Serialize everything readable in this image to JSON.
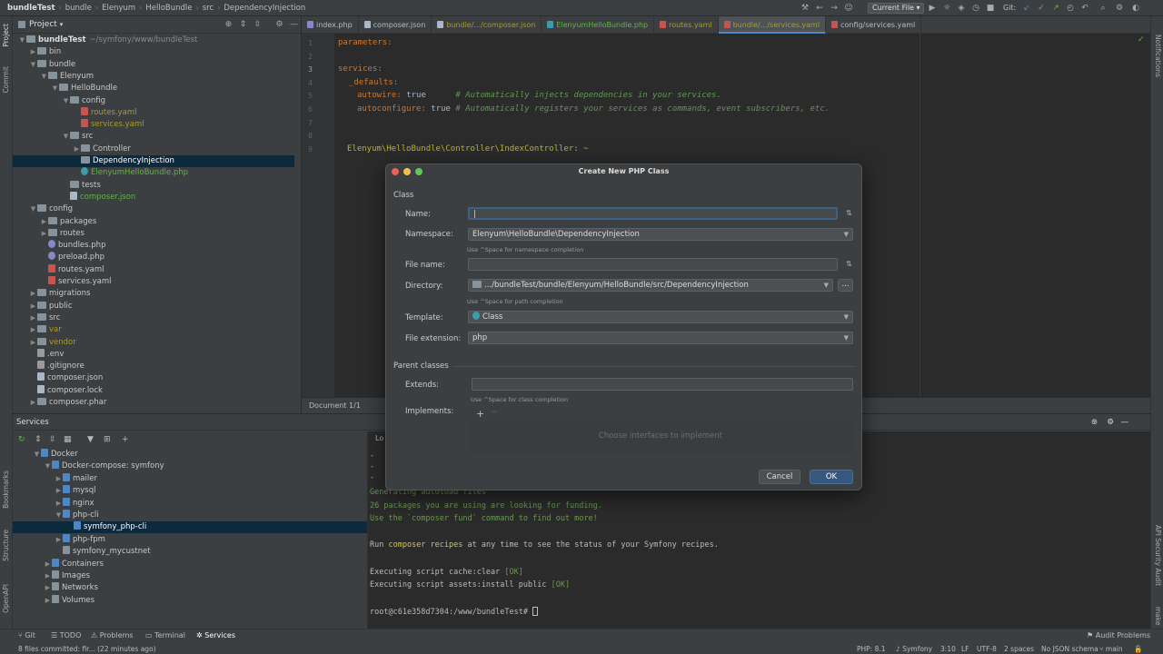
{
  "breadcrumb": {
    "items": [
      "bundleTest",
      "bundle",
      "Elenyum",
      "HelloBundle",
      "src",
      "DependencyInjection"
    ]
  },
  "toolbar": {
    "run_config": "Current File",
    "git_label": "Git:"
  },
  "left_strip": {
    "project": "Project",
    "commit": "Commit",
    "bookmarks": "Bookmarks",
    "structure": "Structure",
    "openapi": "OpenAPI"
  },
  "right_strip": {
    "notifications": "Notifications",
    "api_audit": "API Security Audit",
    "make": "make"
  },
  "project_panel": {
    "title": "Project",
    "tree": [
      {
        "label": "bundleTest",
        "extra": "~/symfony/www/bundleTest",
        "type": "folder",
        "depth": 0,
        "open": true,
        "bold": true
      },
      {
        "label": "bin",
        "type": "folder",
        "depth": 1,
        "open": false
      },
      {
        "label": "bundle",
        "type": "folder",
        "depth": 1,
        "open": true
      },
      {
        "label": "Elenyum",
        "type": "folder",
        "depth": 2,
        "open": true
      },
      {
        "label": "HelloBundle",
        "type": "folder",
        "depth": 3,
        "open": true
      },
      {
        "label": "config",
        "type": "folder",
        "depth": 4,
        "open": true
      },
      {
        "label": "routes.yaml",
        "type": "yaml",
        "depth": 5,
        "color": "olive"
      },
      {
        "label": "services.yaml",
        "type": "yaml",
        "depth": 5,
        "color": "olive"
      },
      {
        "label": "src",
        "type": "folder",
        "depth": 4,
        "open": true
      },
      {
        "label": "Controller",
        "type": "folder",
        "depth": 5,
        "open": false
      },
      {
        "label": "DependencyInjection",
        "type": "folder",
        "depth": 5,
        "selected": true
      },
      {
        "label": "ElenyumHelloBundle.php",
        "type": "cls",
        "depth": 5,
        "color": "green"
      },
      {
        "label": "tests",
        "type": "folder",
        "depth": 4
      },
      {
        "label": "composer.json",
        "type": "json",
        "depth": 4,
        "color": "green"
      },
      {
        "label": "config",
        "type": "folder",
        "depth": 1,
        "open": true
      },
      {
        "label": "packages",
        "type": "folder",
        "depth": 2,
        "open": false
      },
      {
        "label": "routes",
        "type": "folder",
        "depth": 2,
        "open": false
      },
      {
        "label": "bundles.php",
        "type": "php",
        "depth": 2
      },
      {
        "label": "preload.php",
        "type": "php",
        "depth": 2
      },
      {
        "label": "routes.yaml",
        "type": "yaml",
        "depth": 2
      },
      {
        "label": "services.yaml",
        "type": "yaml",
        "depth": 2
      },
      {
        "label": "migrations",
        "type": "folder",
        "depth": 1,
        "open": false
      },
      {
        "label": "public",
        "type": "folder",
        "depth": 1,
        "open": false
      },
      {
        "label": "src",
        "type": "folder",
        "depth": 1,
        "open": false
      },
      {
        "label": "var",
        "type": "folder",
        "depth": 1,
        "open": false,
        "color": "olive"
      },
      {
        "label": "vendor",
        "type": "folder",
        "depth": 1,
        "open": false,
        "color": "olive"
      },
      {
        "label": ".env",
        "type": "txt",
        "depth": 1
      },
      {
        "label": ".gitignore",
        "type": "txt",
        "depth": 1
      },
      {
        "label": "composer.json",
        "type": "json",
        "depth": 1
      },
      {
        "label": "composer.lock",
        "type": "json",
        "depth": 1
      },
      {
        "label": "composer.phar",
        "type": "folder",
        "depth": 1,
        "open": false
      }
    ]
  },
  "tabs": [
    {
      "label": "index.php",
      "icon": "#8888c6"
    },
    {
      "label": "composer.json",
      "icon": "#a9b7c6"
    },
    {
      "label": "bundle/.../composer.json",
      "icon": "#a9b7c6",
      "color": "olive"
    },
    {
      "label": "ElenyumHelloBundle.php",
      "icon": "#3d9cab",
      "color": "green"
    },
    {
      "label": "routes.yaml",
      "icon": "#c75450",
      "color": "olive"
    },
    {
      "label": "bundle/.../services.yaml",
      "icon": "#c75450",
      "color": "olive",
      "active": true
    },
    {
      "label": "config/services.yaml",
      "icon": "#c75450"
    }
  ],
  "editor": {
    "lines": [
      "1",
      "2",
      "3",
      "4",
      "5",
      "6",
      "7",
      "8",
      "9"
    ],
    "code": {
      "l1": "parameters:",
      "l3": "services:",
      "l4": "_defaults:",
      "l5_key": "autowire:",
      "l5_val": " true",
      "l5_comment": "# Automatically injects dependencies in your services.",
      "l6_key": "autoconfigure:",
      "l6_val": " true",
      "l6_comment": "# Automatically registers your services as commands, event subscribers, etc.",
      "l9": "Elenyum\\HelloBundle\\Controller\\IndexController: ~"
    },
    "status": "Document 1/1"
  },
  "services_panel": {
    "title": "Services",
    "tree": [
      {
        "label": "Docker",
        "depth": 0,
        "open": true,
        "icon": "docker"
      },
      {
        "label": "Docker-compose: symfony",
        "depth": 1,
        "open": true,
        "icon": "compose"
      },
      {
        "label": "mailer",
        "depth": 2,
        "open": false,
        "icon": "box"
      },
      {
        "label": "mysql",
        "depth": 2,
        "open": false,
        "icon": "box"
      },
      {
        "label": "nginx",
        "depth": 2,
        "open": false,
        "icon": "box"
      },
      {
        "label": "php-cli",
        "depth": 2,
        "open": true,
        "icon": "box"
      },
      {
        "label": "symfony_php-cli",
        "depth": 3,
        "selected": true,
        "icon": "box"
      },
      {
        "label": "php-fpm",
        "depth": 2,
        "open": false,
        "icon": "box"
      },
      {
        "label": "symfony_mycustnet",
        "depth": 2,
        "icon": "net"
      },
      {
        "label": "Containers",
        "depth": 1,
        "open": false,
        "icon": "box"
      },
      {
        "label": "Images",
        "depth": 1,
        "open": false,
        "icon": "img"
      },
      {
        "label": "Networks",
        "depth": 1,
        "open": false,
        "icon": "net"
      },
      {
        "label": "Volumes",
        "depth": 1,
        "open": false,
        "icon": "vol"
      }
    ]
  },
  "terminal": {
    "tab": "Lo",
    "lines": [
      {
        "text": "Generating autoload files",
        "cls": "tg"
      },
      {
        "text": "26 packages you are using are looking for funding.",
        "cls": "tg"
      },
      {
        "text": "Use the `composer fund` command to find out more!",
        "cls": "tg"
      },
      {
        "text": "",
        "cls": ""
      },
      {
        "segments": [
          {
            "t": "Run ",
            "c": ""
          },
          {
            "t": "composer recipes",
            "c": "ty"
          },
          {
            "t": " at any time to see the status of your Symfony recipes.",
            "c": ""
          }
        ]
      },
      {
        "text": "",
        "cls": ""
      },
      {
        "segments": [
          {
            "t": "Executing script cache:clear ",
            "c": ""
          },
          {
            "t": "[OK]",
            "c": "tg"
          }
        ]
      },
      {
        "segments": [
          {
            "t": "Executing script assets:install public ",
            "c": ""
          },
          {
            "t": "[OK]",
            "c": "tg"
          }
        ]
      },
      {
        "text": "",
        "cls": ""
      },
      {
        "text": "root@c61e358d7304:/www/bundleTest# ",
        "cls": ""
      }
    ]
  },
  "dialog": {
    "title": "Create New PHP Class",
    "section_class": "Class",
    "name_label": "Name:",
    "name_value": "",
    "namespace_label": "Namespace:",
    "namespace_value": "Elenyum\\HelloBundle\\DependencyInjection",
    "namespace_hint": "Use ^Space for namespace completion",
    "filename_label": "File name:",
    "filename_value": "",
    "directory_label": "Directory:",
    "directory_value": ".../bundleTest/bundle/Elenyum/HelloBundle/src/DependencyInjection",
    "directory_hint": "Use ^Space for path completion",
    "browse": "...",
    "template_label": "Template:",
    "template_value": "Class",
    "extension_label": "File extension:",
    "extension_value": "php",
    "section_parent": "Parent classes",
    "extends_label": "Extends:",
    "extends_value": "",
    "extends_hint": "Use ^Space for class completion",
    "implements_label": "Implements:",
    "implements_add": "+",
    "implements_empty": "Choose interfaces to implement",
    "cancel": "Cancel",
    "ok": "OK"
  },
  "bottom_tabs": {
    "git": "Git",
    "todo": "TODO",
    "problems": "Problems",
    "terminal": "Terminal",
    "services": "Services",
    "audit": "Audit Problems"
  },
  "status_bar": {
    "commit_msg": "8 files committed: fir... (22 minutes ago)",
    "php": "PHP: 8.1",
    "symfony": "Symfony",
    "pos": "3:10",
    "lf": "LF",
    "enc": "UTF-8",
    "indent": "2 spaces",
    "schema": "No JSON schema",
    "branch": "main"
  }
}
